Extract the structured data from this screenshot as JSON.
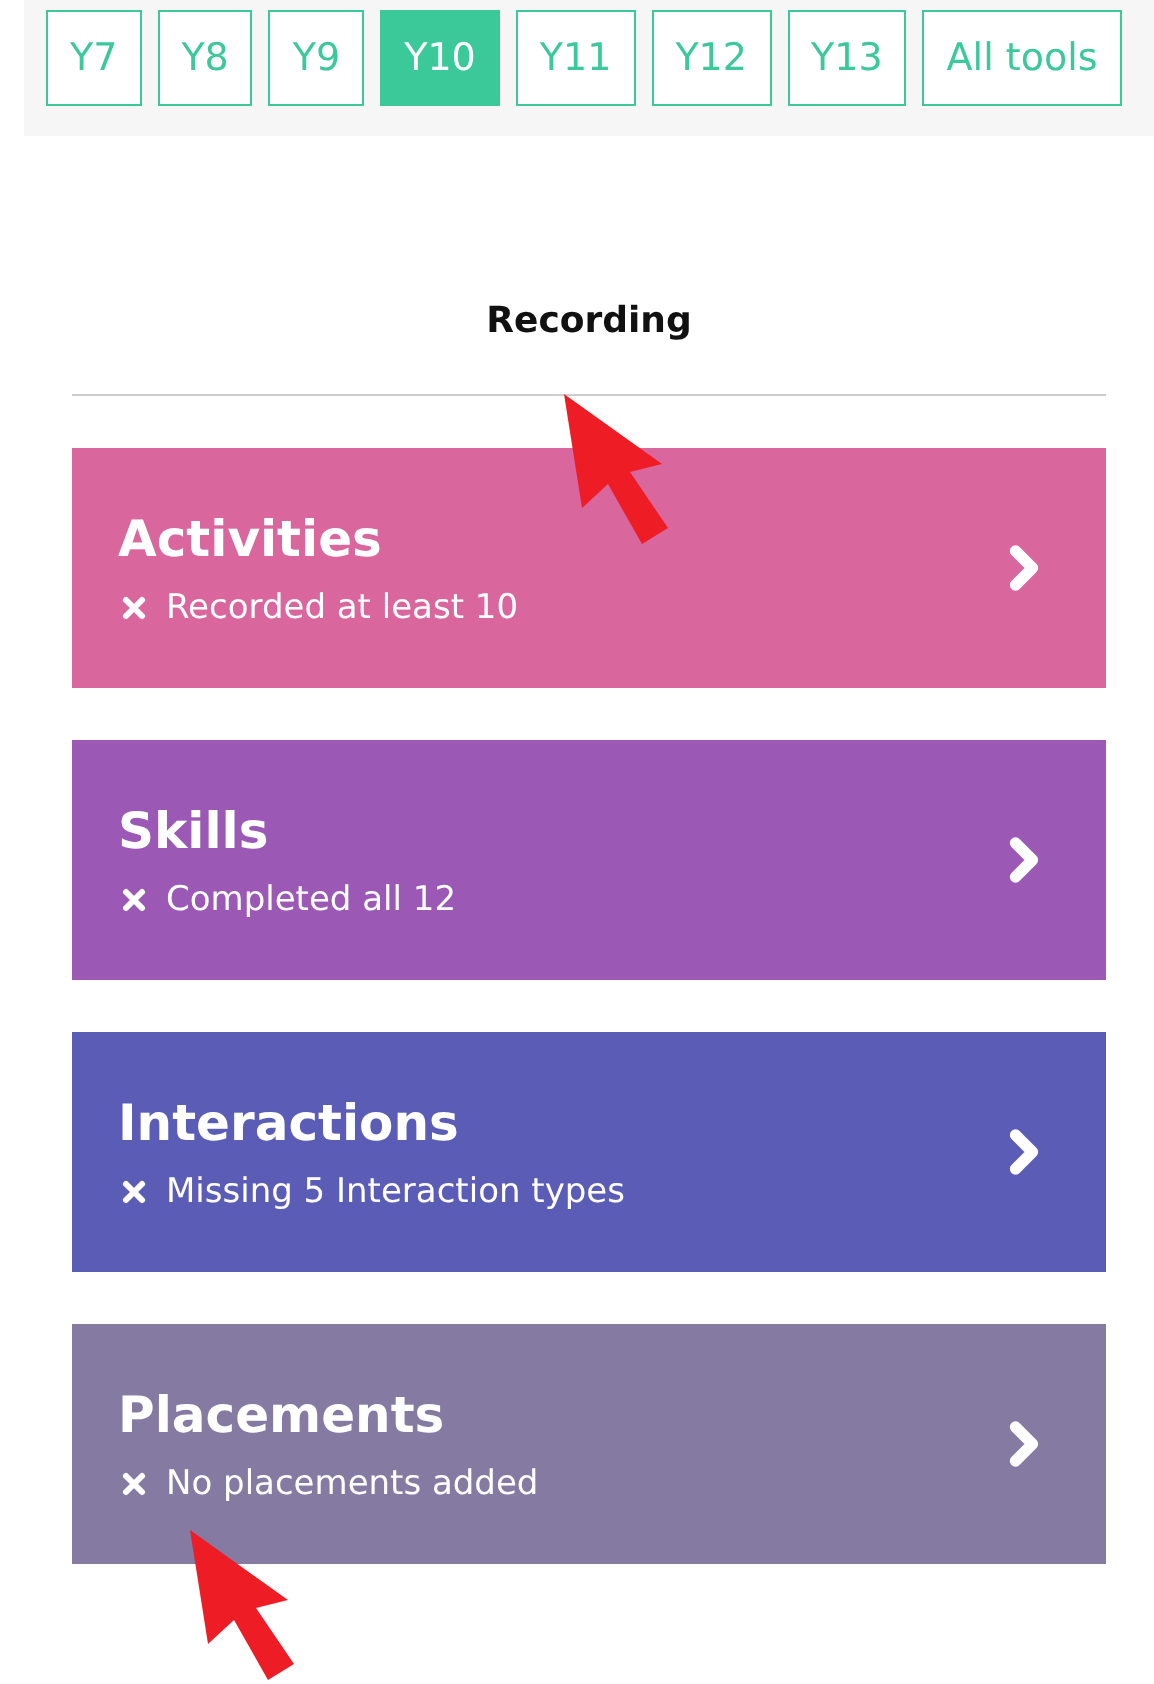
{
  "year_tabs": [
    {
      "label": "Y7",
      "selected": false
    },
    {
      "label": "Y8",
      "selected": false
    },
    {
      "label": "Y9",
      "selected": false
    },
    {
      "label": "Y10",
      "selected": true
    },
    {
      "label": "Y11",
      "selected": false
    },
    {
      "label": "Y12",
      "selected": false
    },
    {
      "label": "Y13",
      "selected": false
    },
    {
      "label": "All tools",
      "selected": false
    }
  ],
  "section_title": "Recording",
  "cards": [
    {
      "title": "Activities",
      "status": "Recorded at least 10",
      "color": "#d9669c"
    },
    {
      "title": "Skills",
      "status": "Completed all 12",
      "color": "#9b59b5"
    },
    {
      "title": "Interactions",
      "status": "Missing 5 Interaction types",
      "color": "#5b5cb6"
    },
    {
      "title": "Placements",
      "status": "No placements added",
      "color": "#847aa2"
    }
  ]
}
